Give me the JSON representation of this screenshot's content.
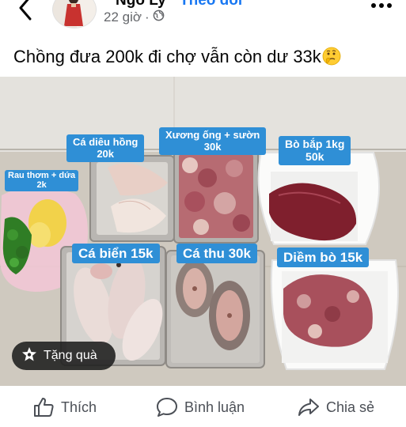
{
  "post": {
    "author": "Ngô Ly",
    "follow_label": "Theo dõi",
    "time": "22 giờ",
    "privacy_icon": "globe-icon",
    "caption": "Chồng đưa 200k đi chợ vẫn còn dư 33k",
    "caption_emoji": "thinking-face-emoji"
  },
  "photo": {
    "labels": [
      {
        "id": "rau",
        "name": "Rau thơm + dứa",
        "price": "2k"
      },
      {
        "id": "ca-dieu-hong",
        "name": "Cá diêu hồng",
        "price": "20k"
      },
      {
        "id": "xuong-ong",
        "name": "Xương ống + sườn",
        "price": "30k"
      },
      {
        "id": "bo-bap",
        "name": "Bò bắp 1kg",
        "price": "50k"
      },
      {
        "id": "ca-bien",
        "name": "Cá biển 15k"
      },
      {
        "id": "ca-thu",
        "name": "Cá thu 30k"
      },
      {
        "id": "diem-bo",
        "name": "Diềm bò 15k"
      }
    ],
    "gift_label": "Tặng quà",
    "gift_icon": "gift-icon"
  },
  "actions": {
    "like_label": "Thích",
    "comment_label": "Bình luận",
    "share_label": "Chia sẻ"
  },
  "colors": {
    "label_bg": "#2f8fd6",
    "link": "#1877f2",
    "meta_text": "#65676b"
  }
}
